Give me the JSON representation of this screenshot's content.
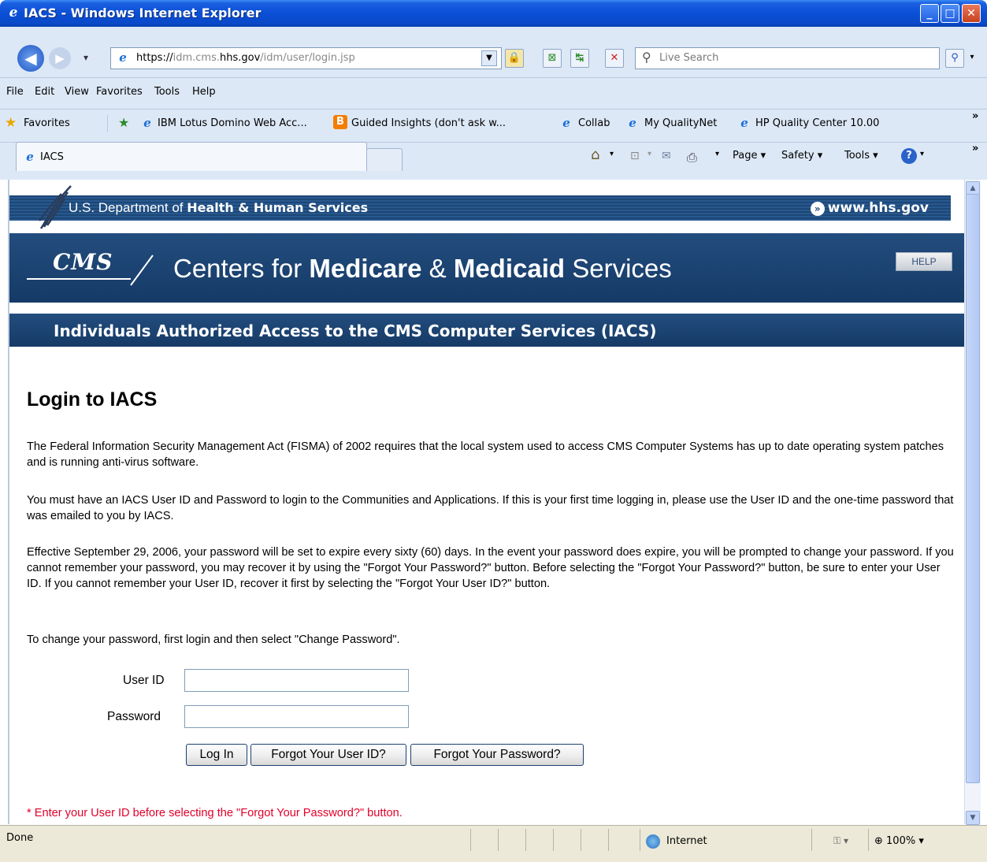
{
  "window": {
    "title": "IACS - Windows Internet Explorer"
  },
  "address": {
    "url_prefix": "https://",
    "url_host_pre": "idm.cms.",
    "url_host": "hhs.gov",
    "url_path": "/idm/user/login.jsp"
  },
  "search": {
    "placeholder": "Live Search"
  },
  "menu": {
    "file": "File",
    "edit": "Edit",
    "view": "View",
    "favorites": "Favorites",
    "tools": "Tools",
    "help": "Help"
  },
  "favorites_bar": {
    "favorites": "Favorites",
    "items": [
      "IBM Lotus Domino Web Acc...",
      "Guided Insights (don't ask w...",
      "Collab",
      "My QualityNet",
      "HP Quality Center 10.00"
    ]
  },
  "tab": {
    "label": "IACS"
  },
  "command_bar": {
    "page": "Page",
    "safety": "Safety",
    "tools": "Tools"
  },
  "hhs_banner": {
    "dept_prefix": "U.S. Department of ",
    "dept_bold": "Health & Human Services",
    "link": "www.hhs.gov"
  },
  "cms_banner": {
    "logo": "CMS",
    "name_1": "Centers for ",
    "name_bold_1": "Medicare",
    "name_2": " & ",
    "name_bold_2": "Medicaid",
    "name_3": " Services",
    "help": "HELP"
  },
  "iacs_bar": {
    "text": "Individuals Authorized Access to the CMS Computer Services (IACS)"
  },
  "content": {
    "heading": "Login to IACS",
    "p1": "The Federal Information Security Management Act (FISMA) of 2002 requires that the local system used to access CMS Computer Systems has up to date operating system patches and is running anti-virus software.",
    "p2": "You must have an IACS User ID and Password to login to the Communities and Applications. If this is your first time logging in, please use the User ID and the one-time password that was emailed to you by IACS.",
    "p3": "Effective September 29, 2006, your password will be set to expire every sixty (60) days. In the event your password does expire, you will be prompted to change your password. If you cannot remember your password, you may recover it by using the \"Forgot Your Password?\" button. Before selecting the \"Forgot Your Password?\" button, be sure to enter your User ID. If you cannot remember your User ID, recover it first by selecting the \"Forgot Your User ID?\" button.",
    "p4": "To change your password, first login and then select \"Change Password\".",
    "userid_label": "User ID",
    "password_label": "Password",
    "userid_value": "",
    "password_value": "",
    "login_btn": "Log In",
    "forgot_user_btn": "Forgot Your User ID?",
    "forgot_pw_btn": "Forgot Your Password?",
    "note": "* Enter your User ID before selecting the \"Forgot Your Password?\" button."
  },
  "status": {
    "text": "Done",
    "zone": "Internet",
    "zoom": "100%"
  },
  "colors": {
    "banner_navy": "#1d4777",
    "note_red": "#e0002a",
    "xp_blue": "#0a4fd6"
  }
}
